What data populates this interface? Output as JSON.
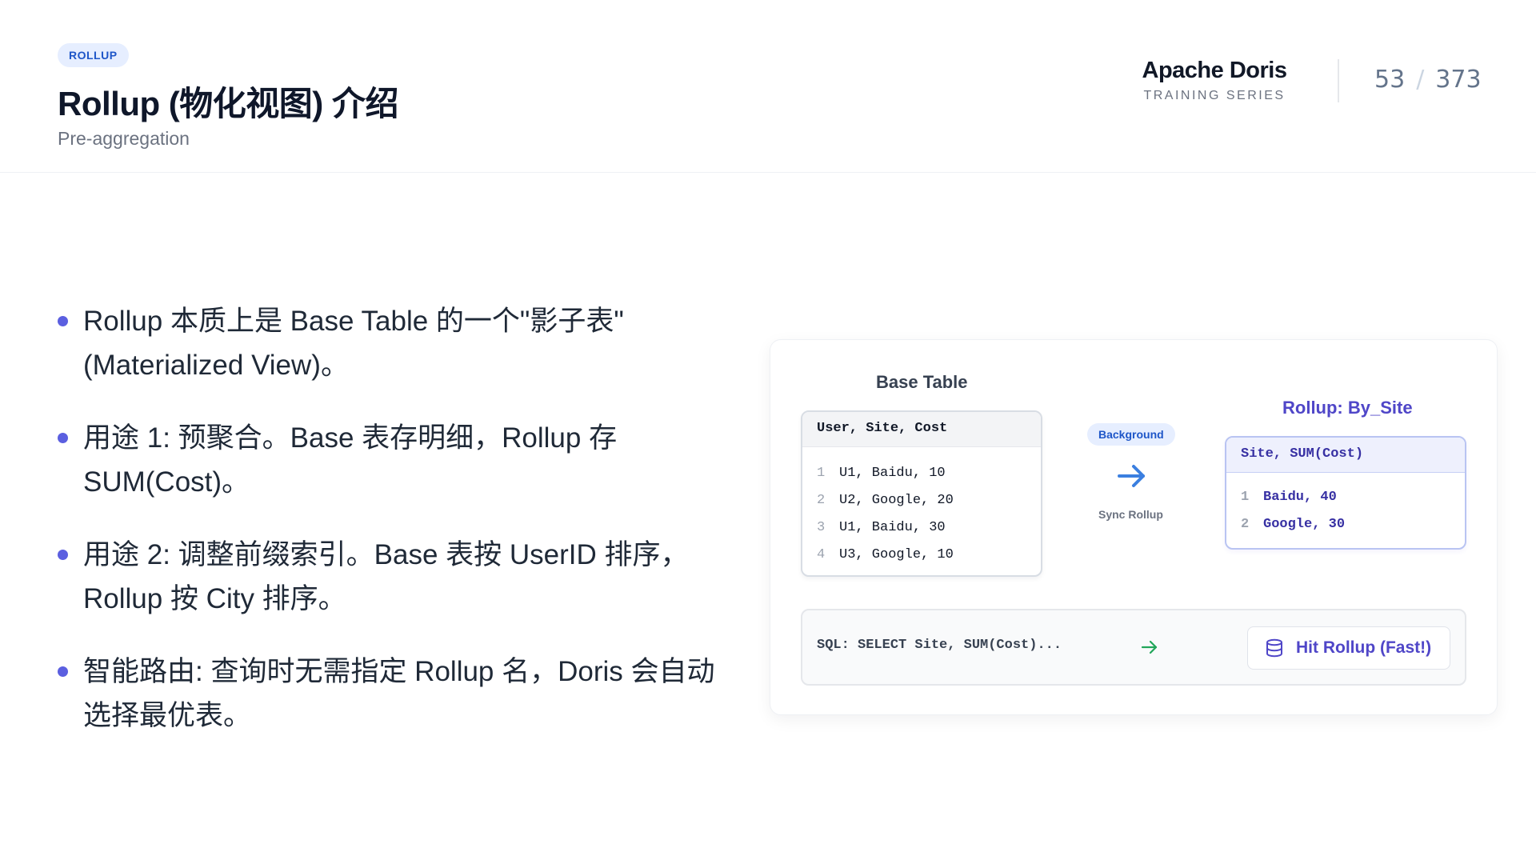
{
  "header": {
    "tag": "ROLLUP",
    "title": "Rollup (物化视图) 介绍",
    "subtitle": "Pre-aggregation",
    "brand_name": "Apache Doris",
    "brand_sub": "TRAINING SERIES",
    "page_current": "53",
    "page_separator": "/",
    "page_total": "373"
  },
  "bullets": [
    "Rollup 本质上是 Base Table 的一个\"影子表\" (Materialized View)。",
    "用途 1: 预聚合。Base 表存明细，Rollup 存 SUM(Cost)。",
    "用途 2: 调整前缀索引。Base 表按 UserID 排序，Rollup 按 City 排序。",
    "智能路由: 查询时无需指定 Rollup 名，Doris 会自动选择最优表。"
  ],
  "diagram": {
    "base_label": "Base Table",
    "base_header": "User, Site, Cost",
    "base_rows": [
      {
        "num": "1",
        "text": "U1, Baidu, 10"
      },
      {
        "num": "2",
        "text": "U2, Google, 20"
      },
      {
        "num": "3",
        "text": "U1, Baidu, 30"
      },
      {
        "num": "4",
        "text": "U3, Google, 10"
      }
    ],
    "badge": "Background",
    "sync_label": "Sync Rollup",
    "rollup_label": "Rollup: By_Site",
    "rollup_header": "Site, SUM(Cost)",
    "rollup_rows": [
      {
        "num": "1",
        "text": "Baidu, 40"
      },
      {
        "num": "2",
        "text": "Google, 30"
      }
    ],
    "sql": "SQL: SELECT Site, SUM(Cost)...",
    "hit_label": "Hit Rollup (Fast!)"
  },
  "colors": {
    "accent": "#4f46c8",
    "badge_bg": "#e6eeff",
    "badge_text": "#1e56c8",
    "arrow_blue": "#3b7fe0",
    "arrow_green": "#22a65a"
  },
  "icons": {
    "arrow": "arrow-right-icon",
    "sql_arrow": "arrow-right-icon",
    "hit": "database-icon"
  }
}
